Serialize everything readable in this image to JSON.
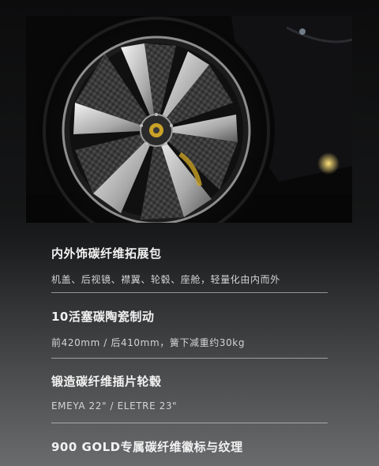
{
  "hero": {
    "image": "carbon-fiber-wheel-photo"
  },
  "features": [
    {
      "title": "内外饰碳纤维拓展包",
      "desc": "机盖、后视镜、襟翼、轮毂、座舱，轻量化由内而外"
    },
    {
      "title": "10活塞碳陶瓷制动",
      "desc": "前420mm / 后410mm，簧下减重约30kg"
    },
    {
      "title": "锻造碳纤维插片轮毂",
      "desc": "EMEYA 22\" / ELETRE 23\""
    },
    {
      "title": "900 GOLD专属碳纤维徽标与纹理",
      "desc": ""
    }
  ],
  "colors": {
    "accent_gold": "#c9a227",
    "text": "#f2f2f2"
  }
}
